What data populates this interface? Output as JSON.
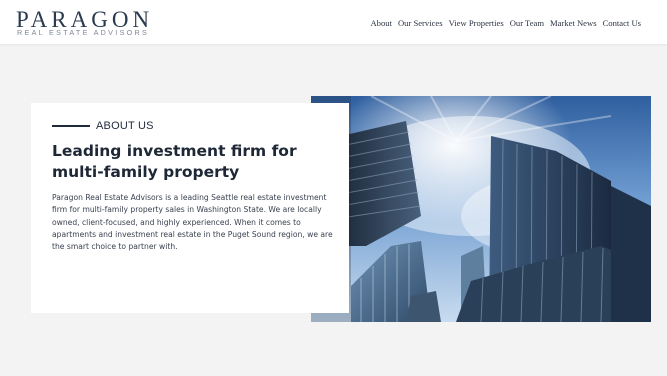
{
  "brand": {
    "name": "PARAGON",
    "tagline": "REAL ESTATE ADVISORS"
  },
  "nav": {
    "items": [
      {
        "label": "About"
      },
      {
        "label": "Our Services"
      },
      {
        "label": "View Properties"
      },
      {
        "label": "Our Team"
      },
      {
        "label": "Market News"
      },
      {
        "label": "Contact Us"
      }
    ]
  },
  "about": {
    "eyebrow": "ABOUT US",
    "heading": "Leading investment firm for multi-family property",
    "body": "Paragon Real Estate Advisors is a leading Seattle real estate investment firm for multi-family property sales in Washington State. We are locally owned, client-focused, and highly experienced. When it comes to apartments and investment real estate in the Puget Sound region, we are the smart choice to partner with."
  },
  "colors": {
    "brand_navy": "#2a3a4f",
    "text_dark": "#1f2a3b",
    "page_bg": "#f3f3f4",
    "sky_blue": "#4f7fb8"
  },
  "images": {
    "hero": "skyscrapers-photo"
  }
}
